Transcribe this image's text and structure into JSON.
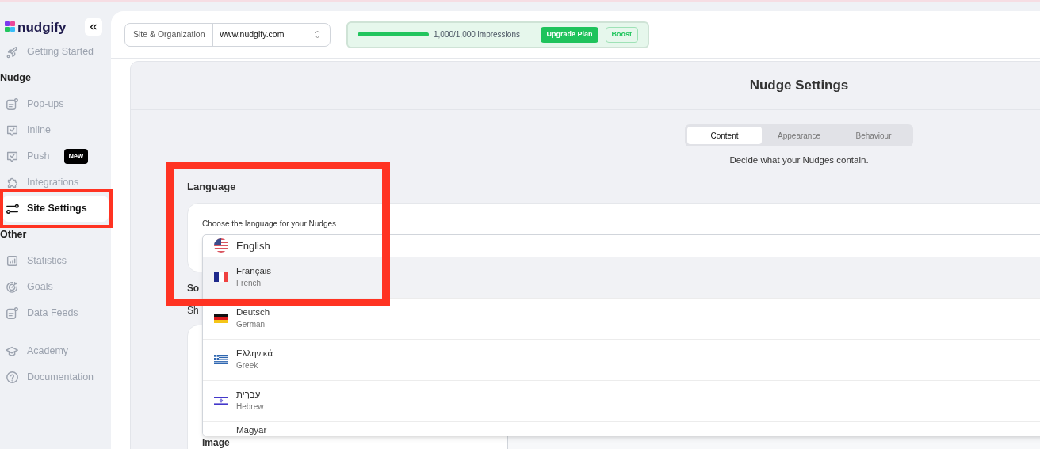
{
  "brand": {
    "name": "nudgify"
  },
  "sidebar": {
    "sections": [
      {
        "items": [
          {
            "label": "Getting Started",
            "selected": false
          }
        ]
      },
      {
        "title": "Nudge",
        "items": [
          {
            "label": "Pop-ups",
            "selected": false
          },
          {
            "label": "Inline",
            "selected": false
          },
          {
            "label": "Push",
            "selected": false,
            "badge": "New"
          },
          {
            "label": "Integrations",
            "selected": false
          },
          {
            "label": "Site Settings",
            "selected": true
          }
        ]
      },
      {
        "title": "Other",
        "items": [
          {
            "label": "Statistics",
            "selected": false
          },
          {
            "label": "Goals",
            "selected": false
          },
          {
            "label": "Data Feeds",
            "selected": false
          }
        ]
      },
      {
        "items": [
          {
            "label": "Academy",
            "selected": false
          },
          {
            "label": "Documentation",
            "selected": false
          }
        ]
      }
    ]
  },
  "header": {
    "site_selector": {
      "label": "Site & Organization",
      "value": "www.nudgify.com"
    },
    "usage": {
      "level": 1,
      "text": "1,000/1,000 impressions",
      "buttons": [
        {
          "kind": "primary",
          "label": "Upgrade Plan"
        },
        {
          "kind": "outline",
          "label": "Boost"
        }
      ]
    }
  },
  "settings": {
    "title": "Nudge Settings",
    "tabs": [
      {
        "label": "Content",
        "selected": true
      },
      {
        "label": "Appearance",
        "selected": false
      },
      {
        "label": "Behaviour",
        "selected": false
      }
    ],
    "description": "Decide what your Nudges contain.",
    "language": {
      "heading": "Language",
      "field_label": "Choose the language for your Nudges",
      "dropdown": {
        "value": "English",
        "options": [
          {
            "label": "Français",
            "sublabel": "French",
            "highlighted": true
          },
          {
            "label": "Deutsch",
            "sublabel": "German",
            "highlighted": false
          },
          {
            "label": "Ελληνικά",
            "sublabel": "Greek",
            "highlighted": false
          },
          {
            "label": "עִברִית",
            "sublabel": "Hebrew",
            "highlighted": false
          },
          {
            "label": "Magyar",
            "highlighted": false
          }
        ]
      }
    },
    "next_section": {
      "heading": "So",
      "text": "Sh",
      "image_label": "Image"
    }
  }
}
